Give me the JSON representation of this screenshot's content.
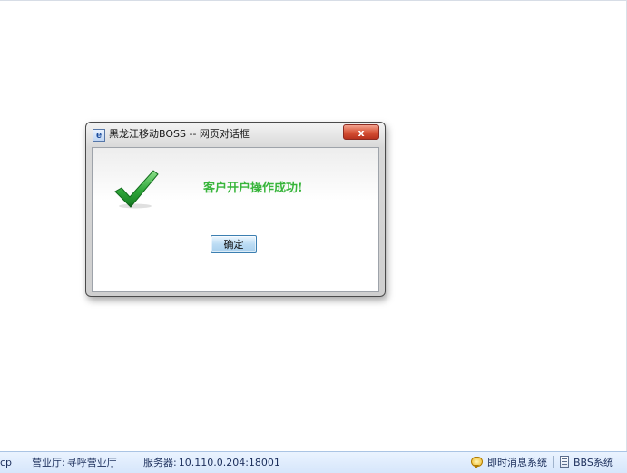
{
  "dialog": {
    "title": "黑龙江移动BOSS -- 网页对话框",
    "close_label": "x",
    "message": "客户开户操作成功!",
    "ok_label": "确定",
    "title_icon_glyph": "e"
  },
  "status_bar": {
    "left_fragment": "cp",
    "hall_label": "营业厅:",
    "hall_value": "寻呼营业厅",
    "server_label": "服务器:",
    "server_value": "10.110.0.204:18001",
    "im_link": "即时消息系统",
    "bbs_link": "BBS系统"
  },
  "colors": {
    "success_text": "#38b53b",
    "check_icon": "#2fa63a",
    "close_button": "#d55034",
    "status_bar_bg": "#d6e6fb"
  },
  "icons": {
    "title": "ie-page-icon",
    "success": "checkmark-icon",
    "im": "chat-bubble-icon",
    "bbs": "document-icon"
  }
}
